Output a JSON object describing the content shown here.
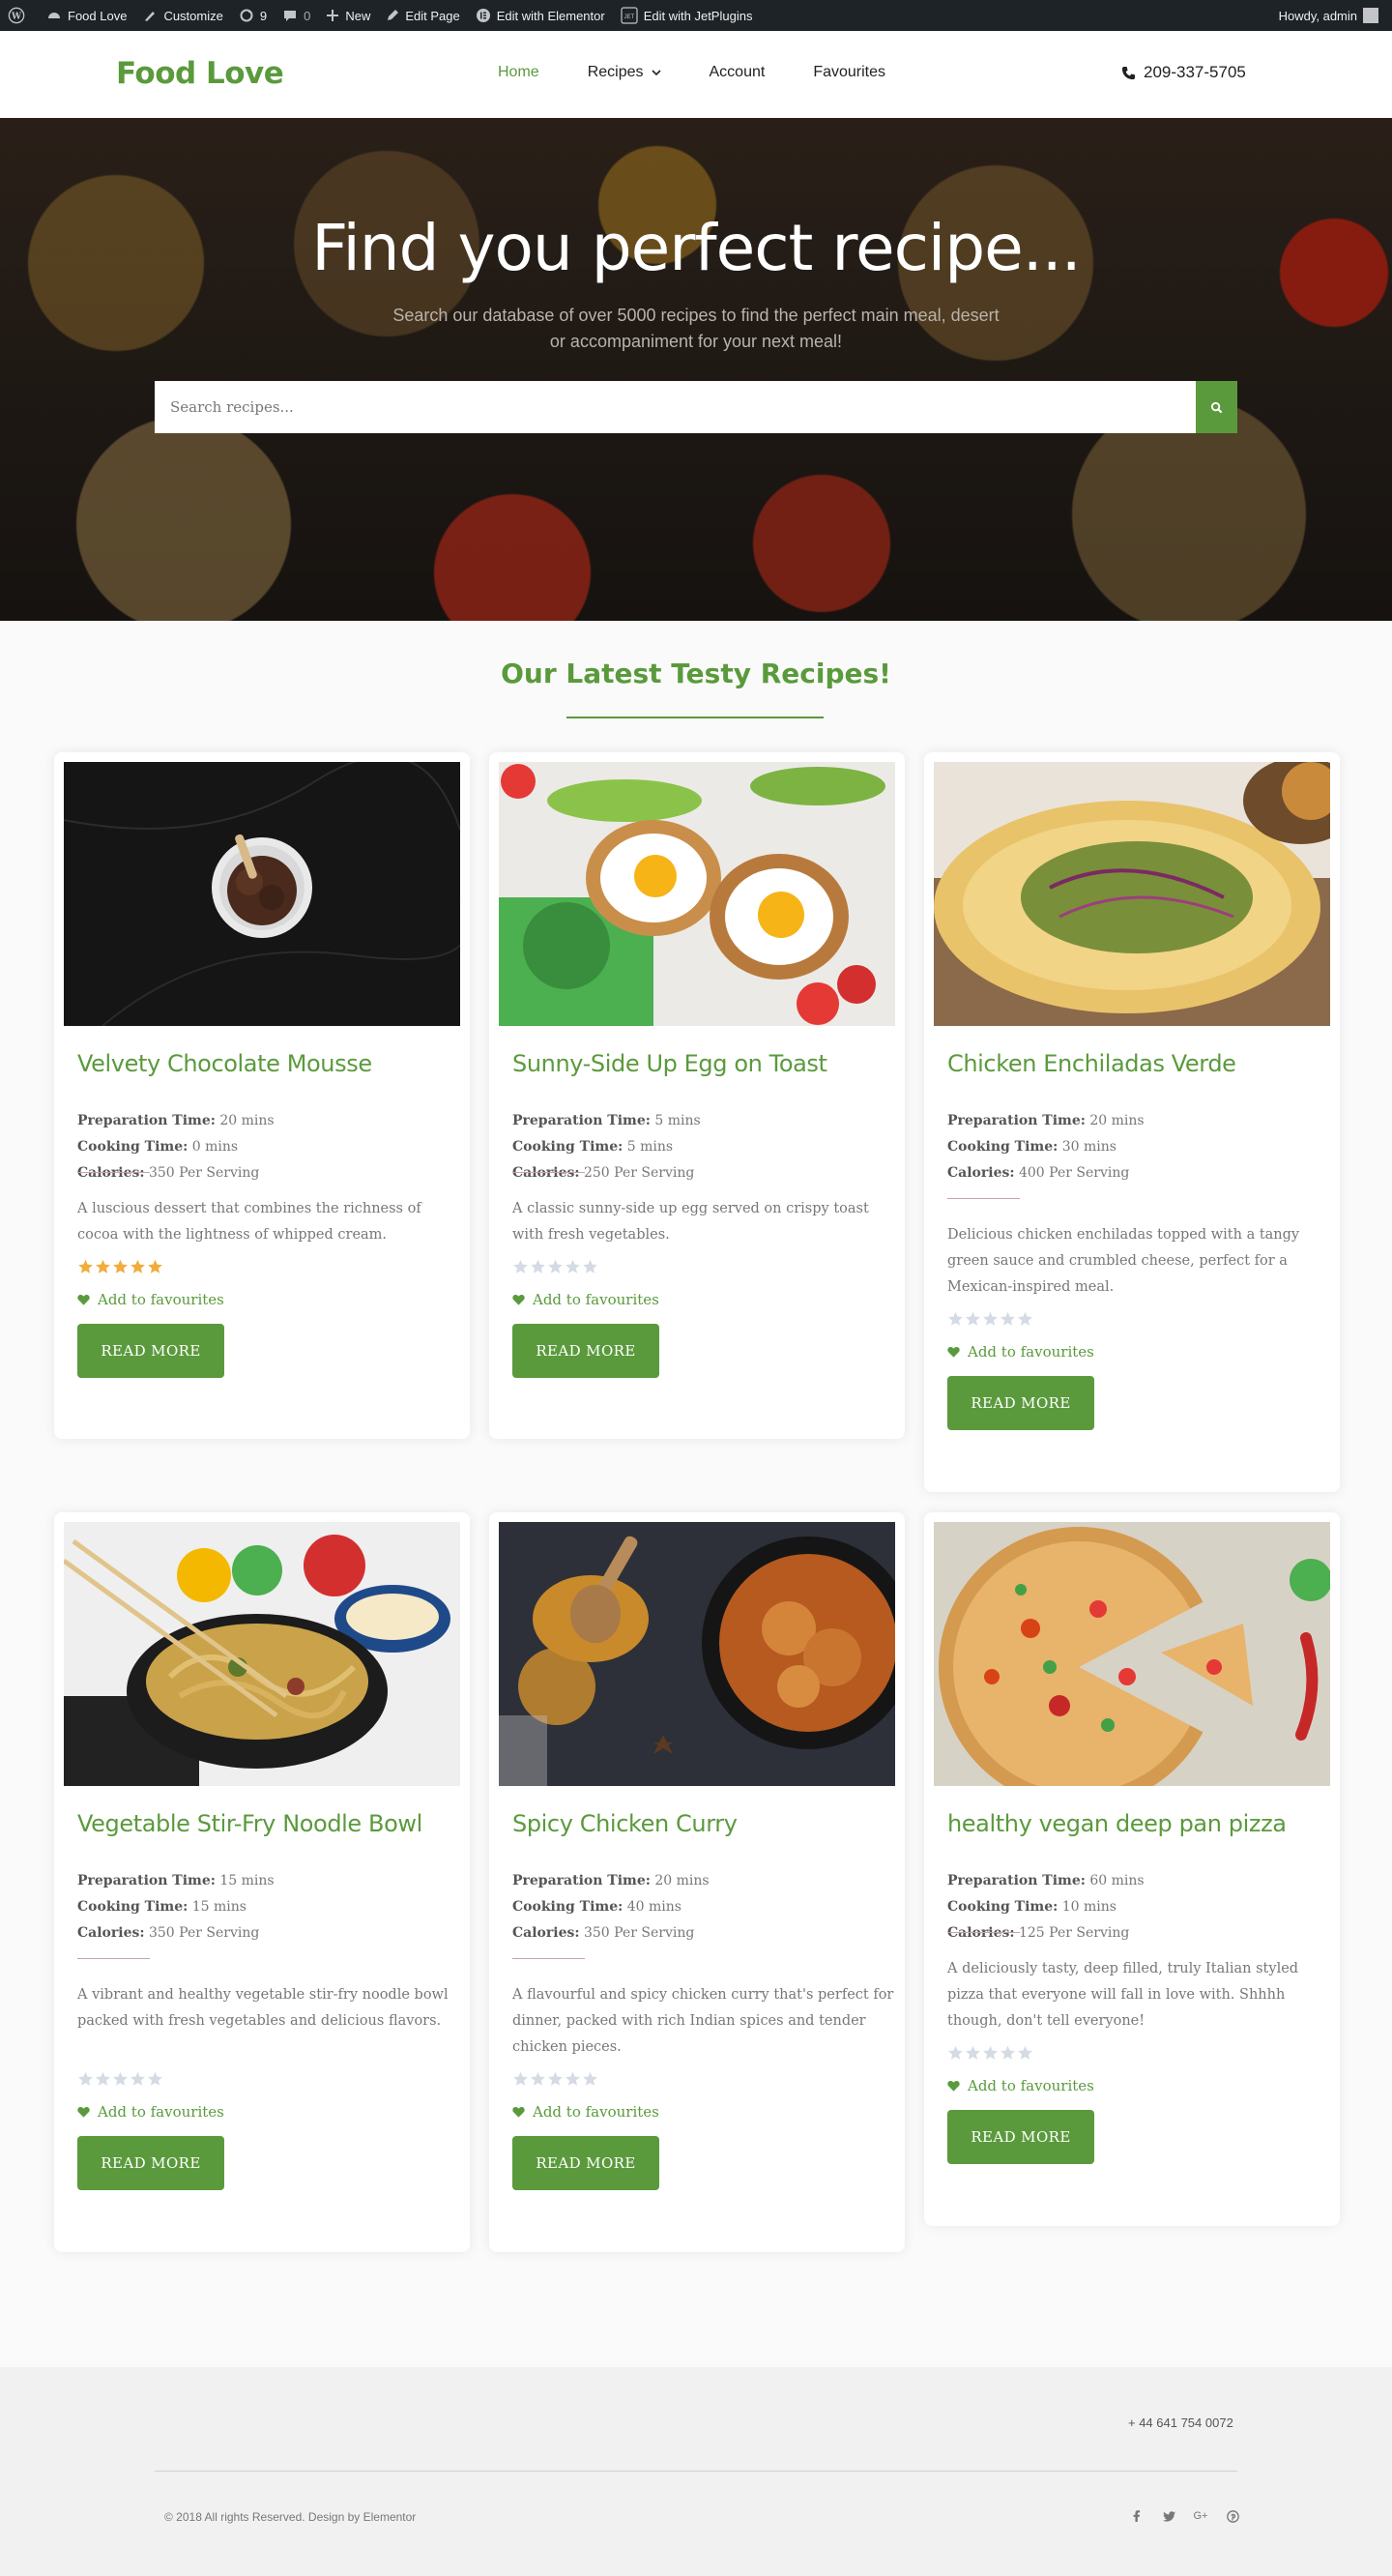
{
  "adminbar": {
    "site_name": "Food Love",
    "customize": "Customize",
    "updates_count": "9",
    "comments_count": "0",
    "new": "New",
    "edit_page": "Edit Page",
    "edit_elementor": "Edit with Elementor",
    "edit_jet": "Edit with JetPlugins",
    "howdy": "Howdy, admin"
  },
  "header": {
    "logo": "Food Love",
    "nav": [
      "Home",
      "Recipes",
      "Account",
      "Favourites"
    ],
    "active_nav": "Home",
    "phone": "209-337-5705"
  },
  "hero": {
    "title": "Find you perfect recipe...",
    "subtitle": "Search our database of over 5000 recipes to find the perfect main meal, desert or accompaniment for your next meal!",
    "search_placeholder": "Search recipes..."
  },
  "section": {
    "title": "Our Latest Testy Recipes!"
  },
  "labels": {
    "prep": "Preparation Time:",
    "cook": "Cooking Time:",
    "cal": "Calories:",
    "fav": "Add to favourites",
    "read_more": "READ MORE"
  },
  "recipes": [
    {
      "title": "Velvety Chocolate Mousse",
      "prep": "20 mins",
      "cook": "0 mins",
      "cal": "350 Per Serving",
      "desc": "A luscious dessert that combines the richness of cocoa with the lightness of whipped cream.",
      "rating": 5
    },
    {
      "title": "Sunny-Side Up Egg on Toast",
      "prep": "5 mins",
      "cook": "5 mins",
      "cal": "250 Per Serving",
      "desc": "A classic sunny-side up egg served on crispy toast with fresh vegetables.",
      "rating": 0
    },
    {
      "title": "Chicken Enchiladas Verde",
      "prep": "20 mins",
      "cook": "30 mins",
      "cal": "400 Per Serving",
      "desc": "Delicious chicken enchiladas topped with a tangy green sauce and crumbled cheese, perfect for a Mexican-inspired meal.",
      "rating": 0
    },
    {
      "title": "Vegetable Stir-Fry Noodle Bowl",
      "prep": "15 mins",
      "cook": "15 mins",
      "cal": "350 Per Serving",
      "desc": "A vibrant and healthy vegetable stir-fry noodle bowl packed with fresh vegetables and delicious flavors.",
      "rating": 0
    },
    {
      "title": "Spicy Chicken Curry",
      "prep": "20 mins",
      "cook": "40 mins",
      "cal": "350 Per Serving",
      "desc": "A flavourful and spicy chicken curry that's perfect for dinner, packed with rich Indian spices and tender chicken pieces.",
      "rating": 0
    },
    {
      "title": "healthy vegan deep pan pizza",
      "prep": "60 mins",
      "cook": "10 mins",
      "cal": "125 Per Serving",
      "desc": "A deliciously tasty, deep filled, truly Italian styled pizza that everyone will fall in love with. Shhhh though, don't tell everyone!",
      "rating": 0
    }
  ],
  "footer": {
    "phone": "+ 44 641 754 0072",
    "copyright": "© 2018 All rights Reserved. Design by Elementor",
    "socials": [
      "facebook-icon",
      "twitter-icon",
      "google-plus-icon",
      "pinterest-icon"
    ]
  },
  "colors": {
    "accent": "#5a9a3c",
    "admin_bar": "#1d2327",
    "star_filled": "#f0ad3c",
    "star_empty": "#d5dbe4"
  }
}
